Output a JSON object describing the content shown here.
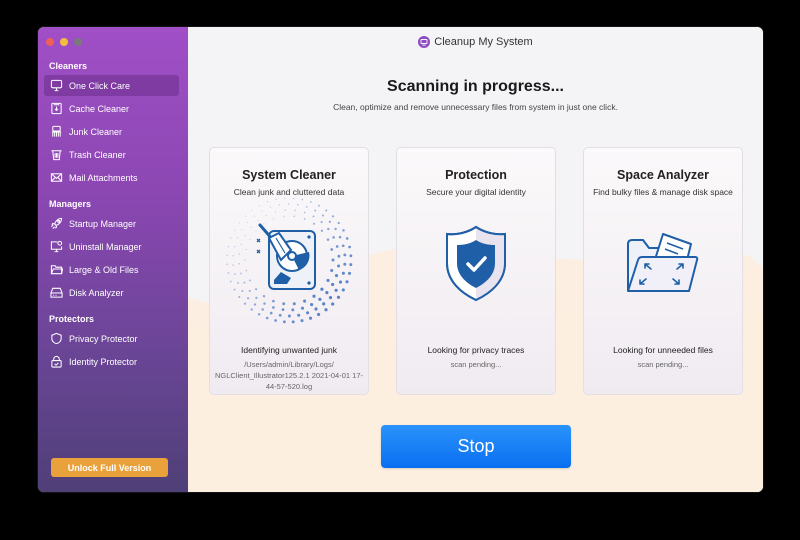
{
  "app": {
    "title": "Cleanup My System"
  },
  "sidebar": {
    "sections": [
      {
        "title": "Cleaners",
        "items": [
          {
            "label": "One Click Care",
            "icon": "monitor-icon",
            "selected": true
          },
          {
            "label": "Cache Cleaner",
            "icon": "cache-icon",
            "selected": false
          },
          {
            "label": "Junk Cleaner",
            "icon": "junk-icon",
            "selected": false
          },
          {
            "label": "Trash Cleaner",
            "icon": "trash-icon",
            "selected": false
          },
          {
            "label": "Mail Attachments",
            "icon": "mail-icon",
            "selected": false
          }
        ]
      },
      {
        "title": "Managers",
        "items": [
          {
            "label": "Startup Manager",
            "icon": "rocket-icon",
            "selected": false
          },
          {
            "label": "Uninstall Manager",
            "icon": "uninstall-icon",
            "selected": false
          },
          {
            "label": "Large & Old Files",
            "icon": "folder-icon",
            "selected": false
          },
          {
            "label": "Disk Analyzer",
            "icon": "disk-icon",
            "selected": false
          }
        ]
      },
      {
        "title": "Protectors",
        "items": [
          {
            "label": "Privacy Protector",
            "icon": "shield-icon",
            "selected": false
          },
          {
            "label": "Identity Protector",
            "icon": "lock-icon",
            "selected": false
          }
        ]
      }
    ],
    "unlock_label": "Unlock Full Version"
  },
  "main": {
    "heading": "Scanning in progress...",
    "subheading": "Clean, optimize and remove unnecessary files from system in just one click.",
    "cards": [
      {
        "title": "System Cleaner",
        "description": "Clean junk and cluttered data",
        "status": "Identifying unwanted junk",
        "detail": "/Users/admin/Library/Logs/ NGLClient_Illustrator125.2.1 2021-04-01 17-44-57-520.log"
      },
      {
        "title": "Protection",
        "description": "Secure your digital identity",
        "status": "Looking for privacy traces",
        "detail": "scan pending..."
      },
      {
        "title": "Space Analyzer",
        "description": "Find bulky files & manage disk space",
        "status": "Looking for unneeded files",
        "detail": "scan pending..."
      }
    ],
    "stop_label": "Stop"
  },
  "colors": {
    "accent_blue": "#0a6ff0",
    "unlock_orange": "#e9a13b",
    "sidebar_purple": "#8c47b3",
    "icon_blue": "#1f5fa8"
  }
}
